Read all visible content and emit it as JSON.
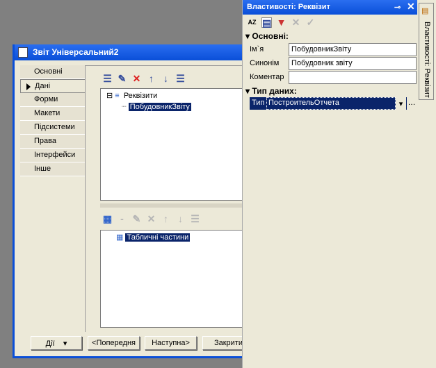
{
  "dialog": {
    "title": "Звіт Універсальний2",
    "tabs": [
      "Основні",
      "Дані",
      "Форми",
      "Макети",
      "Підсистеми",
      "Права",
      "Інтерфейси",
      "Інше"
    ],
    "active_tab": "Дані",
    "attributes_tree": {
      "root": "Реквізити",
      "child": "ПобудовникЗвіту"
    },
    "tables_tree": {
      "root": "Табличні частини"
    },
    "buttons": {
      "actions": "Дії",
      "prev": "<Попередня",
      "next": "Наступна>",
      "close": "Закрити"
    }
  },
  "properties": {
    "title": "Властивості: Реквізит",
    "section_main": "Основні:",
    "fields": [
      {
        "label": "Ім`я",
        "value": "ПобудовникЗвіту"
      },
      {
        "label": "Синонім",
        "value": "Побудовник звіту"
      },
      {
        "label": "Коментар",
        "value": ""
      }
    ],
    "section_type": "Тип даних:",
    "type_label": "Тип",
    "type_value": "ПостроительОтчета",
    "side_tab": "Властивості: Реквізит"
  }
}
